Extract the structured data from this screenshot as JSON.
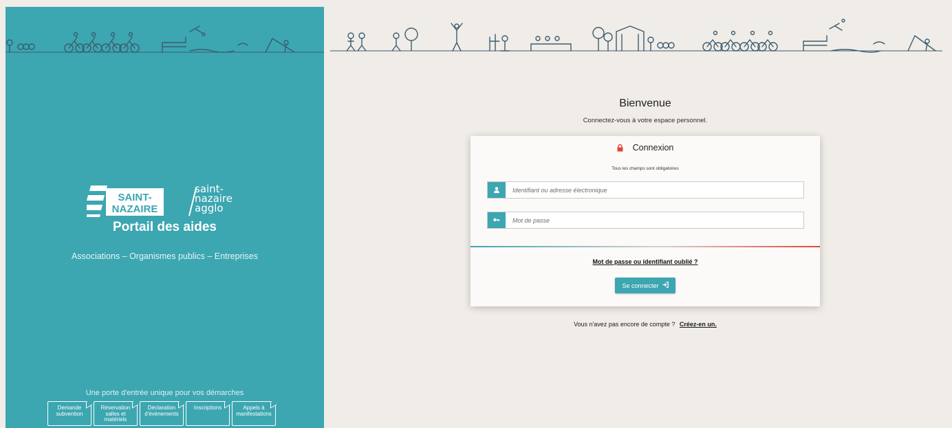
{
  "left": {
    "logo_saint_nazaire_line1": "SAINT-",
    "logo_saint_nazaire_line2": "NAZAIRE",
    "logo_agglo_line1": "saint-",
    "logo_agglo_line2": "nazaire",
    "logo_agglo_line3": "agglo",
    "portal_title": "Portail des aides",
    "audience": "Associations – Organismes publics – Entreprises",
    "tagline": "Une porte d'entrée unique pour vos démarches",
    "tiles": [
      {
        "label": "Demande subvention"
      },
      {
        "label": "Réservation salles et matériels"
      },
      {
        "label": "Déclaration d'évènements"
      },
      {
        "label": "Inscriptions"
      },
      {
        "label": "Appels à manifestations"
      }
    ]
  },
  "welcome": {
    "title": "Bienvenue",
    "subtitle": "Connectez-vous à votre espace personnel."
  },
  "login": {
    "heading": "Connexion",
    "required_note": "Tous les champs sont obligatoires",
    "username_placeholder": "Identifiant ou adresse électronique",
    "password_placeholder": "Mot de passe",
    "forgot_link": "Mot de passe ou identifiant oublié ?",
    "submit_label": "Se connecter"
  },
  "signup": {
    "prompt": "Vous n'avez pas encore de compte ?",
    "link": "Créez-en un."
  },
  "colors": {
    "brand_teal": "#3ca6b1",
    "accent_red": "#e0453a",
    "background": "#f0ece8"
  },
  "icons": [
    "lock-icon",
    "user-icon",
    "key-icon",
    "sign-in-icon"
  ]
}
